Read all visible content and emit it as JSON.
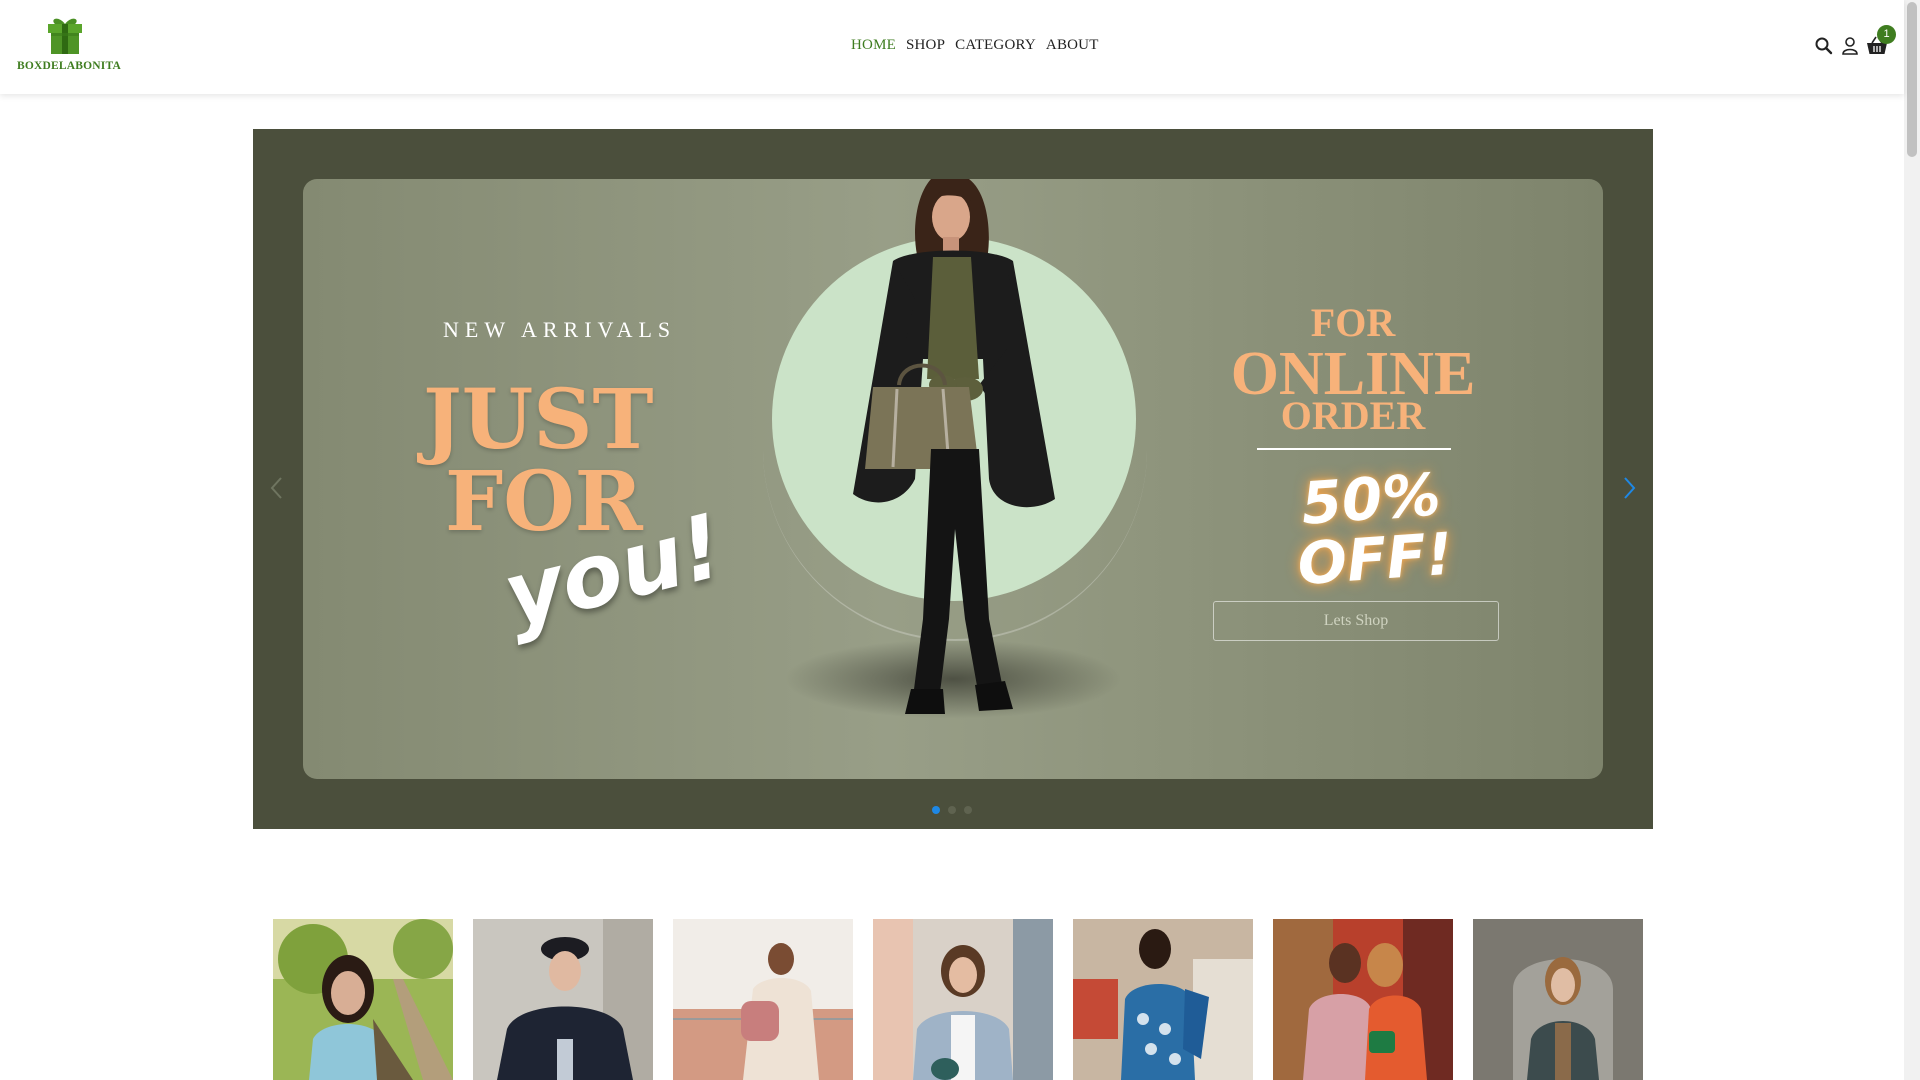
{
  "brand": {
    "name": "BOXDELABONITA",
    "accent": "#3f7d20"
  },
  "nav": {
    "items": [
      {
        "label": "HOME",
        "active": true
      },
      {
        "label": "SHOP",
        "active": false
      },
      {
        "label": "CATEGORY",
        "active": false
      },
      {
        "label": "ABOUT",
        "active": false
      }
    ]
  },
  "header_tools": {
    "search_icon": "search-icon",
    "user_icon": "user-icon",
    "cart_icon": "basket-icon",
    "cart_count": "1"
  },
  "hero": {
    "eyebrow": "NEW ARRIVALS",
    "headline_line1": "JUST",
    "headline_line2": "FOR",
    "headline_script": "you!",
    "promo_for": "FOR",
    "promo_online": "ONLINE",
    "promo_order": "ORDER",
    "promo_discount_line1": "50%",
    "promo_discount_line2": "OFF!",
    "cta_label": "Lets Shop",
    "slide_count": 3,
    "active_slide": 1
  },
  "thumbnails": [
    {
      "name": "woman-with-tote-bag"
    },
    {
      "name": "woman-in-navy-coat"
    },
    {
      "name": "woman-with-pink-backpack"
    },
    {
      "name": "woman-in-grey-cardigan"
    },
    {
      "name": "woman-in-blue-patterned-dress"
    },
    {
      "name": "couple-in-pink-and-floral"
    },
    {
      "name": "woman-under-archway"
    }
  ]
}
